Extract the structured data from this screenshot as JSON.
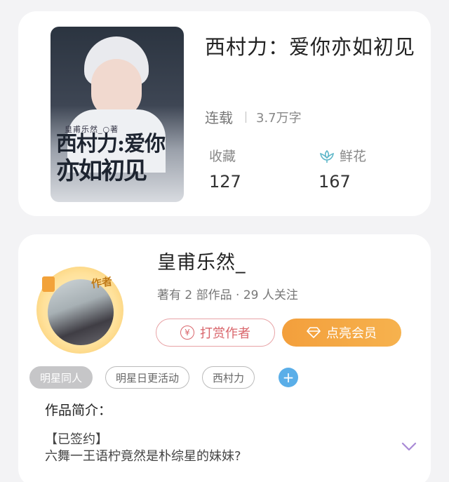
{
  "book": {
    "cover_author": "皇甫乐然_○著",
    "cover_title_line1": "西村力:爱你",
    "cover_title_line2": "亦如初见",
    "title": "西村力：爱你亦如初见",
    "status": "连载",
    "word_count": "3.7万字",
    "stats": {
      "favorites_label": "收藏",
      "favorites_value": "127",
      "flowers_label": "鲜花",
      "flowers_value": "167"
    }
  },
  "author": {
    "badge": "作者",
    "name": "皇甫乐然_",
    "meta": "著有 2 部作品 · 29 人关注",
    "reward_label": "打赏作者",
    "vip_label": "点亮会员"
  },
  "tags": [
    "明星同人",
    "明星日更活动",
    "西村力"
  ],
  "intro": {
    "title": "作品简介：",
    "signed": "【已签约】",
    "text": "六舞一王语柠竟然是朴综星的妹妹?"
  },
  "colors": {
    "accent_orange": "#f39f3c",
    "reward_pink": "#d9656b",
    "tag_add_blue": "#5aaee8",
    "flower_teal": "#5fb7c9",
    "expand_purple": "#a98ad6"
  }
}
